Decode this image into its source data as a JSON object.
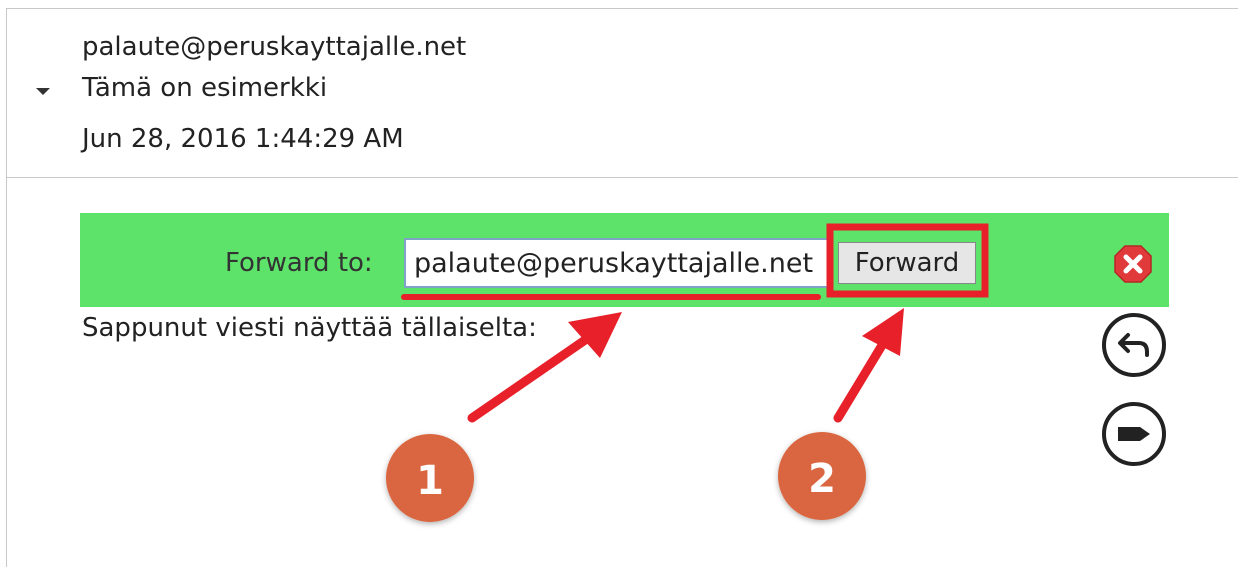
{
  "message": {
    "from": "palaute@peruskayttajalle.net",
    "subject": "Tämä on esimerkki",
    "date": "Jun 28, 2016 1:44:29 AM",
    "body": "Sappunut viesti näyttää tällaiselta:"
  },
  "forward": {
    "label": "Forward to:",
    "input_value": "palaute@peruskayttajalle.net",
    "button_label": "Forward"
  },
  "icons": {
    "collapse": "caret-down-icon",
    "close": "close-icon",
    "reply": "reply-icon",
    "more": "more-actions-icon"
  },
  "annotations": {
    "step1": "1",
    "step2": "2"
  },
  "colors": {
    "forward_bar": "#5ee36a",
    "annotation_red": "#e8202a",
    "step_badge": "#d9663f",
    "close_red": "#e03a3a"
  }
}
